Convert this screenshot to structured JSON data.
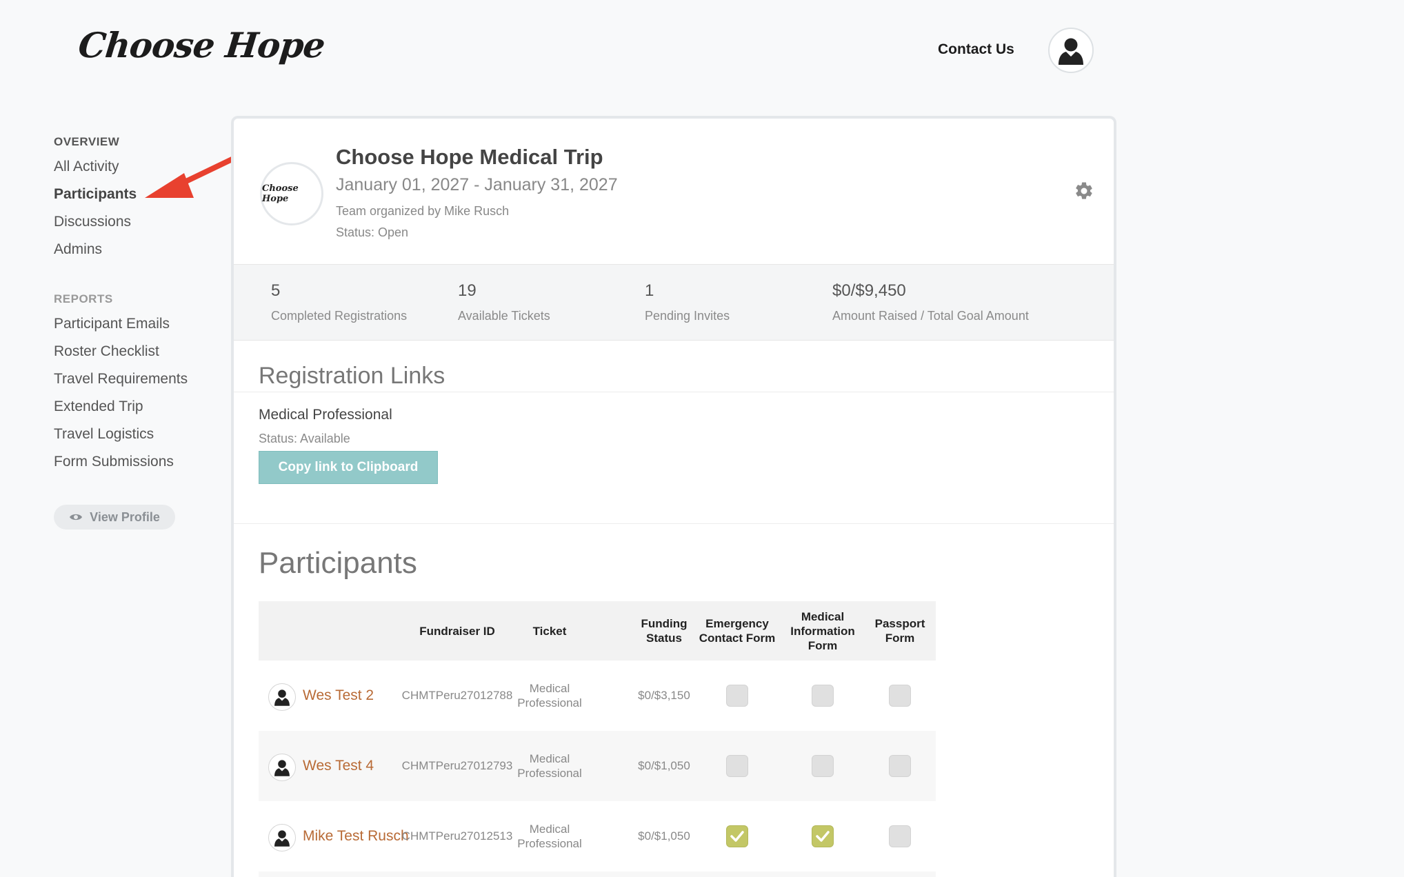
{
  "header": {
    "logo_text": "Choose Hope",
    "contact_label": "Contact Us"
  },
  "sidebar": {
    "overview_heading": "OVERVIEW",
    "overview_items": [
      {
        "label": "All Activity"
      },
      {
        "label": "Participants",
        "active": true
      },
      {
        "label": "Discussions"
      },
      {
        "label": "Admins"
      }
    ],
    "reports_heading": "REPORTS",
    "reports_items": [
      {
        "label": "Participant Emails"
      },
      {
        "label": "Roster Checklist"
      },
      {
        "label": "Travel Requirements"
      },
      {
        "label": "Extended Trip"
      },
      {
        "label": "Travel Logistics"
      },
      {
        "label": "Form Submissions"
      }
    ],
    "view_profile_label": "View Profile"
  },
  "trip": {
    "logo_text": "Choose Hope",
    "title": "Choose Hope Medical Trip",
    "dates": "January 01, 2027 - January 31, 2027",
    "organizer": "Team organized by Mike Rusch",
    "status": "Status: Open"
  },
  "stats": [
    {
      "value": "5",
      "label": "Completed Registrations"
    },
    {
      "value": "19",
      "label": "Available Tickets"
    },
    {
      "value": "1",
      "label": "Pending Invites"
    },
    {
      "value": "$0/$9,450",
      "label": "Amount Raised / Total Goal Amount"
    }
  ],
  "registration": {
    "section_title": "Registration Links",
    "link_name": "Medical Professional",
    "link_status": "Status: Available",
    "copy_label": "Copy link to Clipboard"
  },
  "participants": {
    "section_title": "Participants",
    "columns": {
      "fundraiser_id": "Fundraiser ID",
      "ticket": "Ticket",
      "funding": "Funding Status",
      "emergency": "Emergency Contact Form",
      "medical": "Medical Information Form",
      "passport": "Passport Form"
    },
    "rows": [
      {
        "name": "Wes Test 2",
        "fundraiser_id": "CHMTPeru27012788",
        "ticket": "Medical Professional",
        "funding": "$0/$3,150",
        "emergency": false,
        "medical": false,
        "passport": false
      },
      {
        "name": "Wes Test 4",
        "fundraiser_id": "CHMTPeru27012793",
        "ticket": "Medical Professional",
        "funding": "$0/$1,050",
        "emergency": false,
        "medical": false,
        "passport": false
      },
      {
        "name": "Mike Test Rusch",
        "fundraiser_id": "CHMTPeru27012513",
        "ticket": "Medical Professional",
        "funding": "$0/$1,050",
        "emergency": true,
        "medical": true,
        "passport": false
      }
    ]
  },
  "colors": {
    "accent_link": "#b86a35",
    "copy_button": "#92c9c9",
    "checkbox_checked": "#c3c766",
    "arrow": "#e8412f"
  }
}
